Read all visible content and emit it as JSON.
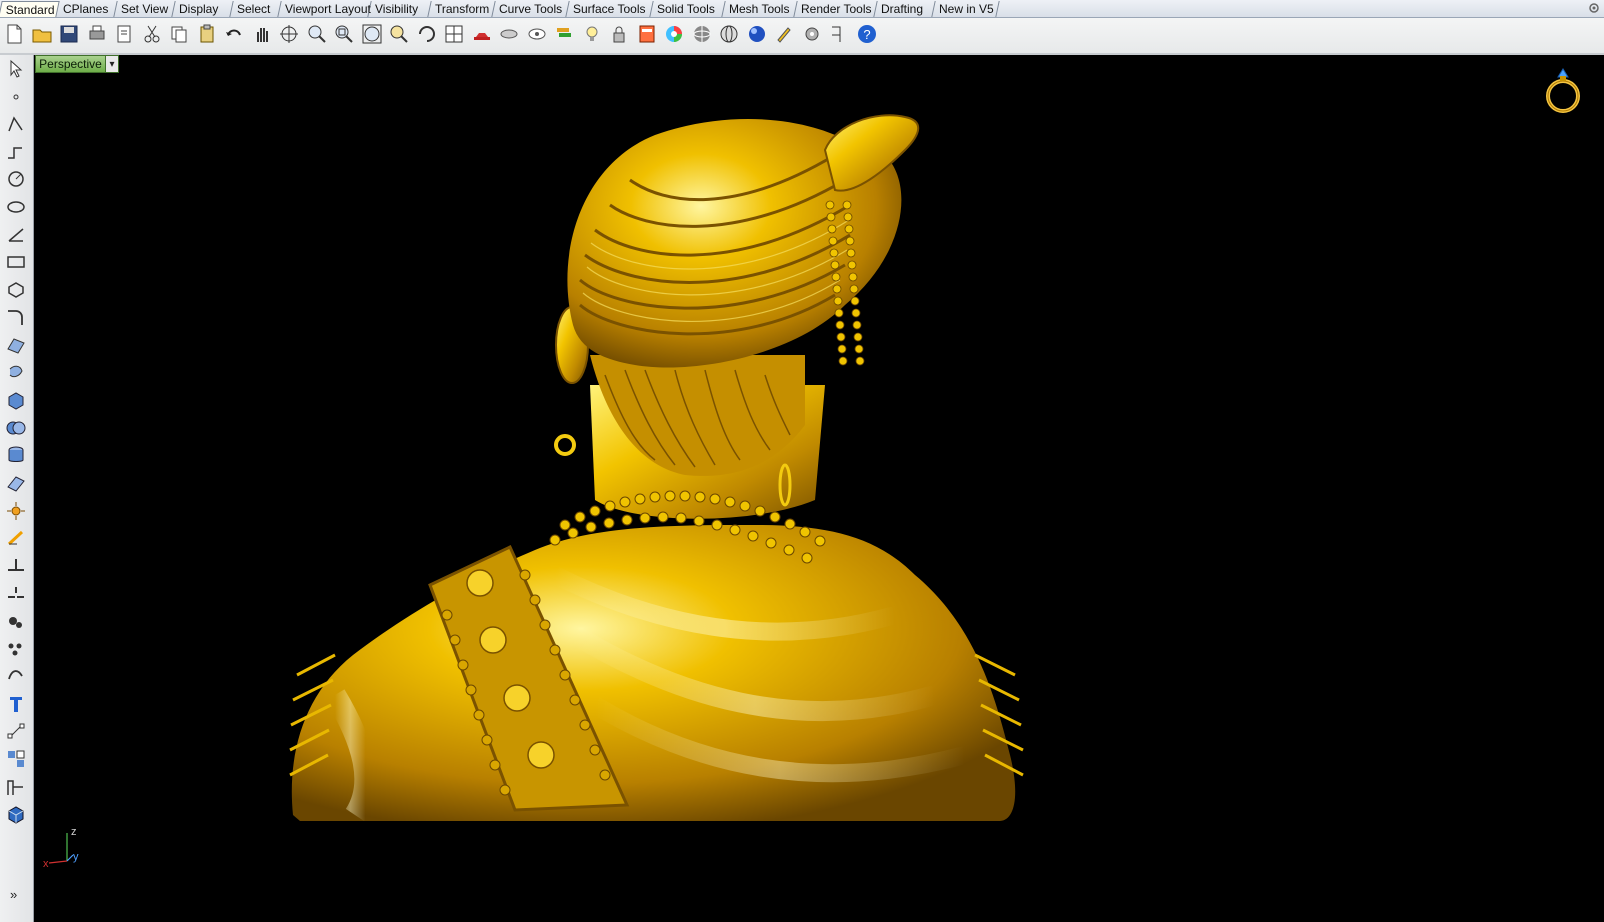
{
  "tabs": [
    {
      "label": "Standard",
      "active": true
    },
    {
      "label": "CPlanes"
    },
    {
      "label": "Set View"
    },
    {
      "label": "Display"
    },
    {
      "label": "Select"
    },
    {
      "label": "Viewport Layout"
    },
    {
      "label": "Visibility"
    },
    {
      "label": "Transform"
    },
    {
      "label": "Curve Tools"
    },
    {
      "label": "Surface Tools"
    },
    {
      "label": "Solid Tools"
    },
    {
      "label": "Mesh Tools"
    },
    {
      "label": "Render Tools"
    },
    {
      "label": "Drafting"
    },
    {
      "label": "New in V5"
    }
  ],
  "toolbar_icons": [
    "new-file-icon",
    "open-folder-icon",
    "save-icon",
    "print-icon",
    "import-icon",
    "cut-icon",
    "copy-icon",
    "paste-icon",
    "undo-icon",
    "pan-hand-icon",
    "rotate-view-icon",
    "zoom-icon",
    "zoom-window-icon",
    "zoom-extents-icon",
    "zoom-selected-icon",
    "undo-view-icon",
    "four-viewports-icon",
    "car-icon",
    "hide-icon",
    "show-icon",
    "layer-icon",
    "light-icon",
    "lock-icon",
    "properties-icon",
    "color-wheel-icon",
    "shaded-sphere-icon",
    "wireframe-sphere-icon",
    "render-sphere-icon",
    "pen-icon",
    "gear-options-icon",
    "grid-snap-icon",
    "help-icon"
  ],
  "sidebar_icons": [
    "select-arrow-icon",
    "point-icon",
    "polyline-icon",
    "curve-icon",
    "circle-icon",
    "ellipse-icon",
    "arc-icon",
    "rectangle-icon",
    "polygon-icon",
    "fillet-icon",
    "surface-icon",
    "revolve-icon",
    "box-icon",
    "boolean-icon",
    "cylinder-icon",
    "plane-icon",
    "explode-icon",
    "edit-point-icon",
    "trim-icon",
    "split-icon",
    "join-icon",
    "array-icon",
    "rebuild-icon",
    "text-icon",
    "scale-icon",
    "group-icon",
    "dimension-icon",
    "solid-box-icon"
  ],
  "viewport": {
    "label": "Perspective",
    "dropdown": "▾",
    "axis_x": "x",
    "axis_y": "y",
    "axis_z": "z",
    "more": "»"
  },
  "colors": {
    "viewport_bg": "#000000",
    "gold": "#e0b400",
    "viewport_tab": "#8fc46c"
  }
}
